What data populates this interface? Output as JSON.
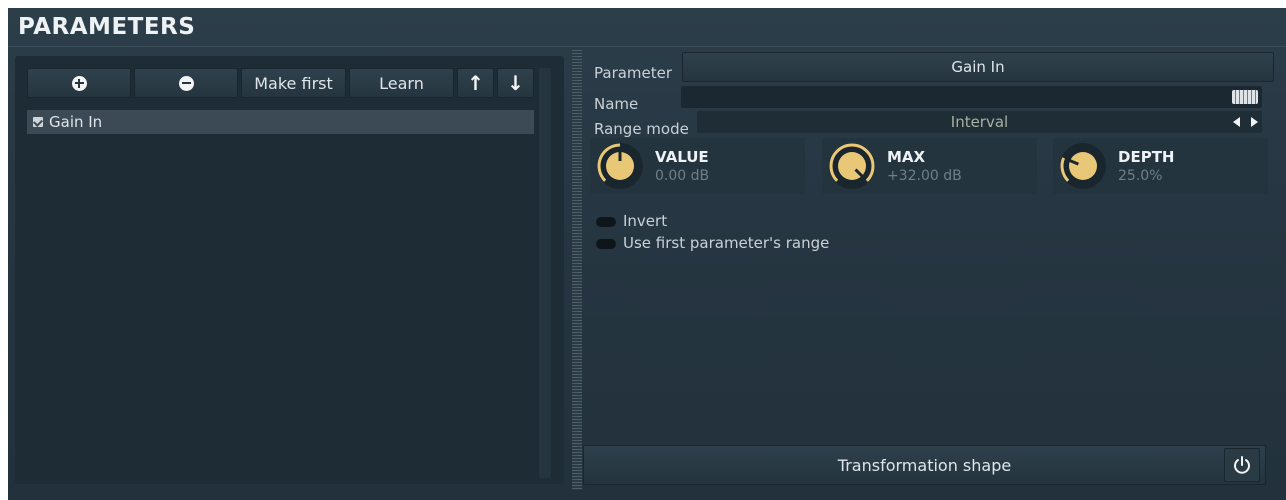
{
  "section": {
    "title": "PARAMETERS"
  },
  "toolbar": {
    "add_icon": "plus-circle-icon",
    "remove_icon": "minus-circle-icon",
    "make_first_label": "Make first",
    "learn_label": "Learn",
    "up_icon": "arrow-up-icon",
    "down_icon": "arrow-down-icon",
    "up_glyph": "↑",
    "down_glyph": "↓"
  },
  "param_list": {
    "items": [
      {
        "label": "Gain In",
        "checked": true
      }
    ]
  },
  "details": {
    "parameter_label": "Parameter",
    "parameter_value": "Gain In",
    "name_label": "Name",
    "name_value": "",
    "range_mode_label": "Range mode",
    "range_mode_value": "Interval"
  },
  "knobs": [
    {
      "name": "VALUE",
      "value": "0.00 dB",
      "level": 0.5
    },
    {
      "name": "MAX",
      "value": "+32.00 dB",
      "level": 1.0
    },
    {
      "name": "DEPTH",
      "value": "25.0%",
      "level": 0.25
    }
  ],
  "options": {
    "invert_label": "Invert",
    "invert_on": false,
    "use_first_label": "Use first parameter's range",
    "use_first_on": false
  },
  "footer": {
    "transform_label": "Transformation shape",
    "power_icon": "power-icon"
  },
  "colors": {
    "accent_knob": "#e8c777",
    "panel": "#1e2c35",
    "background": "#263642"
  }
}
